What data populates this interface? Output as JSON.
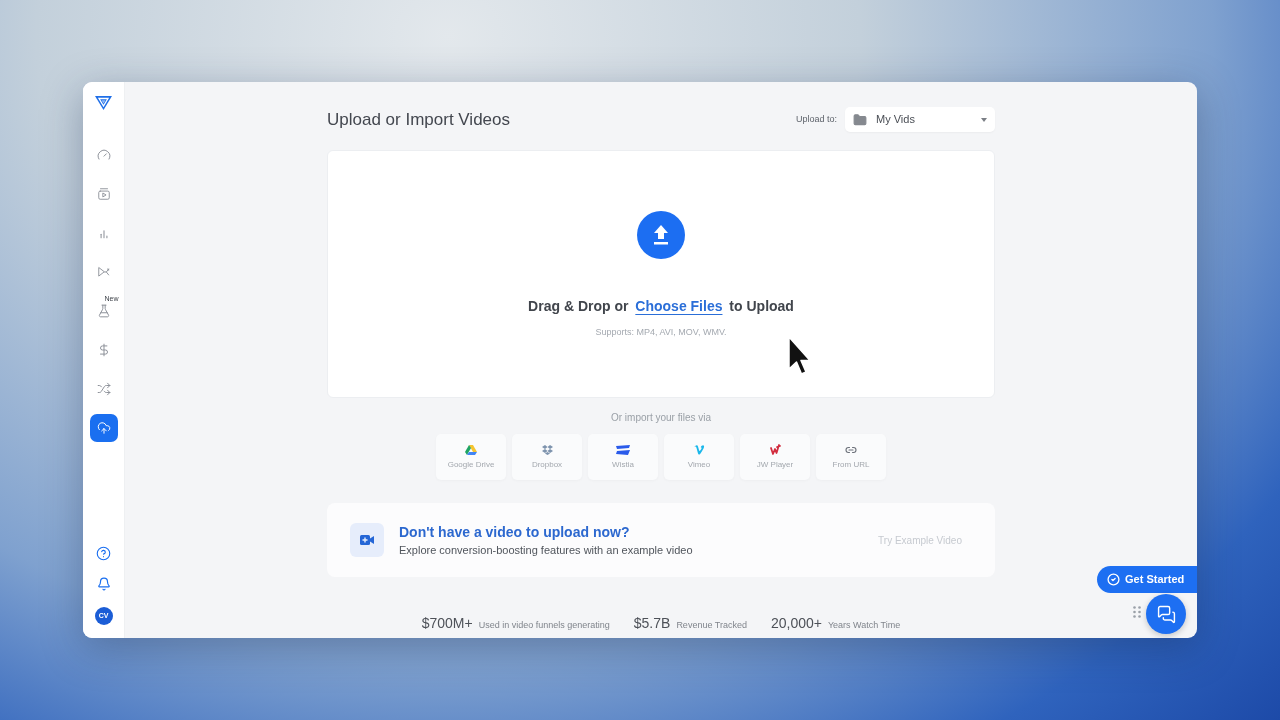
{
  "sidebar": {
    "items": [
      {
        "selected": false
      },
      {
        "selected": false
      },
      {
        "selected": false
      },
      {
        "selected": false
      },
      {
        "selected": false,
        "badge": "New"
      },
      {
        "selected": false
      },
      {
        "selected": false
      },
      {
        "selected": true
      }
    ],
    "avatar": "CV"
  },
  "header": {
    "title": "Upload or Import Videos",
    "upload_to_label": "Upload to:",
    "folder_select": {
      "value": "My Vids"
    }
  },
  "dropzone": {
    "prompt_before": "Drag & Drop or",
    "link": "Choose Files",
    "prompt_after": "to Upload",
    "supports": "Supports: MP4, AVI, MOV, WMV."
  },
  "import": {
    "label": "Or import your files via",
    "sources": [
      {
        "label": "Google Drive"
      },
      {
        "label": "Dropbox"
      },
      {
        "label": "Wistia"
      },
      {
        "label": "Vimeo"
      },
      {
        "label": "JW Player"
      },
      {
        "label": "From URL"
      }
    ]
  },
  "example_banner": {
    "title": "Don't have a video to upload now?",
    "subtitle": "Explore conversion-boosting features with an example video",
    "action": "Try Example Video"
  },
  "stats": [
    {
      "value": "$700M+",
      "label": "Used in video funnels generating"
    },
    {
      "value": "$5.7B",
      "label": "Revenue Tracked"
    },
    {
      "value": "20,000+",
      "label": "Years Watch Time"
    }
  ],
  "get_started": {
    "label": "Get Started"
  }
}
